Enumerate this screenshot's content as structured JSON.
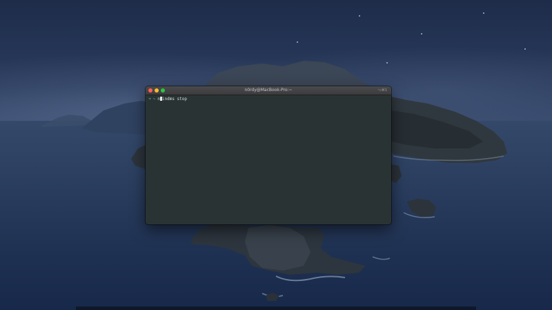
{
  "terminal": {
    "title": "n0rdy@MacBook-Pro:~",
    "shortcut": "⌥⌘1",
    "prompt_arrow": "➜",
    "prompt_dir": "~",
    "command_before_cursor": "n",
    "command_after_cursor": "indms stop"
  },
  "colors": {
    "close": "#fe5f57",
    "minimize": "#febc2e",
    "maximize": "#28c840",
    "terminal_background": "#2a3333",
    "prompt_arrow": "#3fd07a"
  }
}
